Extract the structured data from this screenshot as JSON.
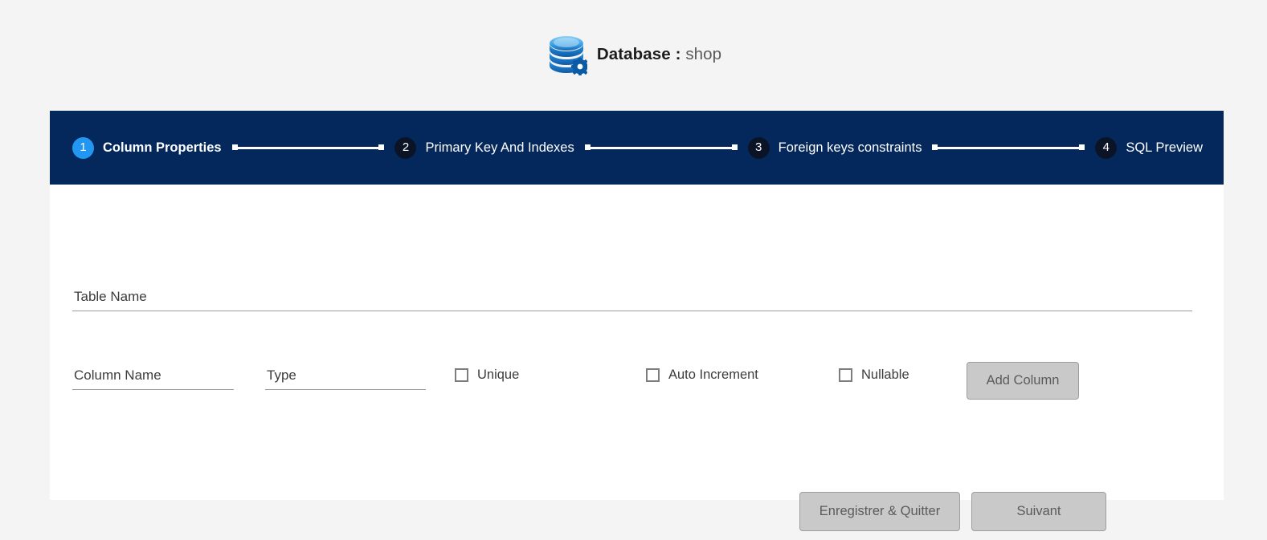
{
  "header": {
    "icon": "database-gear-icon",
    "label": "Database :",
    "database_name": "shop",
    "accent_color": "#1a7fd4"
  },
  "stepper": {
    "background_color": "#05285c",
    "active_circle_color": "#2196f3",
    "inactive_circle_color": "#0a1426",
    "steps": [
      {
        "number": "1",
        "label": "Column Properties",
        "active": true
      },
      {
        "number": "2",
        "label": "Primary Key And Indexes",
        "active": false
      },
      {
        "number": "3",
        "label": "Foreign keys constraints",
        "active": false
      },
      {
        "number": "4",
        "label": "SQL Preview",
        "active": false
      }
    ]
  },
  "form": {
    "table_name": {
      "placeholder": "Table Name",
      "value": ""
    },
    "column_name": {
      "placeholder": "Column Name",
      "value": ""
    },
    "type": {
      "placeholder": "Type",
      "value": ""
    },
    "checkboxes": [
      {
        "label": "Unique",
        "checked": false
      },
      {
        "label": "Auto Increment",
        "checked": false
      },
      {
        "label": "Nullable",
        "checked": false
      }
    ],
    "add_column_label": "Add Column"
  },
  "actions": {
    "save_and_quit_label": "Enregistrer & Quitter",
    "next_label": "Suivant"
  }
}
